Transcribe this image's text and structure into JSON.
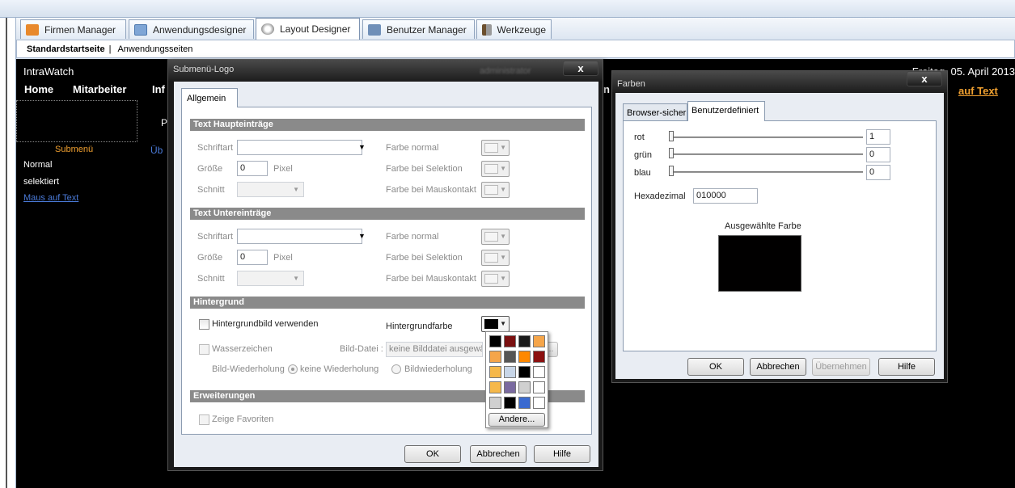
{
  "tabs": [
    {
      "label": "Firmen Manager",
      "icon": "building-icon"
    },
    {
      "label": "Anwendungsdesigner",
      "icon": "window-icon"
    },
    {
      "label": "Layout Designer",
      "icon": "palette-icon"
    },
    {
      "label": "Benutzer Manager",
      "icon": "user-card-icon"
    },
    {
      "label": "Werkzeuge",
      "icon": "tools-icon"
    }
  ],
  "subnav": {
    "active": "Standardstartseite",
    "separator": "|",
    "other": "Anwendungsseiten"
  },
  "preview": {
    "brand": "IntraWatch",
    "date": "Freitag, 05. April 2013",
    "nav": [
      "Home",
      "Mitarbeiter",
      "Inf"
    ],
    "nav_fragment": "n",
    "p_fragment": "P",
    "ul_fragment": "Üb",
    "submenu": "Submenü",
    "items": [
      "Normal",
      "selektiert",
      "Maus auf Text"
    ],
    "right_link": "auf Text"
  },
  "submenu_dialog": {
    "title": "Submenü-Logo",
    "blur_title": "administrator",
    "close": "x",
    "tab": "Allgemein",
    "section_main": "Text Haupteinträge",
    "section_sub": "Text Untereinträge",
    "section_bg": "Hintergrund",
    "section_ext": "Erweiterungen",
    "font_label": "Schriftart",
    "size_label": "Größe",
    "size_value": "0",
    "pixel_label": "Pixel",
    "style_label": "Schnitt",
    "color_normal": "Farbe normal",
    "color_selection": "Farbe bei Selektion",
    "color_hover": "Farbe bei Mauskontakt",
    "use_bg_image": "Hintergrundbild verwenden",
    "bg_color_label": "Hintergrundfarbe",
    "watermark": "Wasserzeichen",
    "image_file_label": "Bild-Datei :",
    "image_file_value": "keine Bilddatei ausgewä",
    "browse": "...",
    "repeat_label": "Bild-Wiederholung",
    "repeat_none": "keine Wiederholung",
    "repeat_yes": "Bildwiederholung",
    "show_favorites": "Zeige Favoriten",
    "ok": "OK",
    "cancel": "Abbrechen",
    "help": "Hilfe",
    "bg_color_value": "#000000"
  },
  "palette": {
    "more": "Andere...",
    "rows": [
      [
        "#000000",
        "#7a1010",
        "#1a1a1a",
        "#f5a54a"
      ],
      [
        "#f5a54a",
        "#555555",
        "#ff8800",
        "#8b1010"
      ],
      [
        "#f5b84a",
        "#c8d6e8",
        "#000000",
        "#ffffff"
      ],
      [
        "#f5b84a",
        "#7a6aa0",
        "#d0d0d0",
        "#ffffff"
      ],
      [
        "#d0d0d0",
        "#000000",
        "#3a6ad0",
        "#ffffff"
      ]
    ]
  },
  "farben_dialog": {
    "title": "Farben",
    "close": "x",
    "tab_browser": "Browser-sicher",
    "tab_custom": "Benutzerdefiniert",
    "red_label": "rot",
    "red_value": "1",
    "green_label": "grün",
    "green_value": "0",
    "blue_label": "blau",
    "blue_value": "0",
    "hex_label": "Hexadezimal",
    "hex_value": "010000",
    "selected_label": "Ausgewählte Farbe",
    "selected_color": "#010000",
    "ok": "OK",
    "cancel": "Abbrechen",
    "apply": "Übernehmen",
    "help": "Hilfe"
  }
}
